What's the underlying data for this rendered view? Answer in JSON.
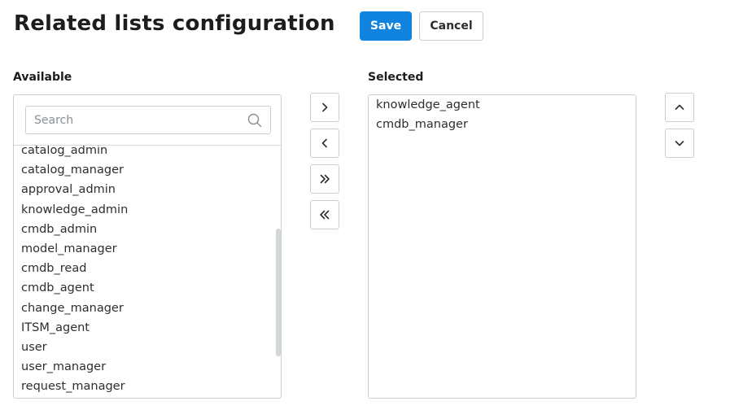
{
  "page": {
    "title": "Related lists configuration"
  },
  "toolbar": {
    "save_label": "Save",
    "cancel_label": "Cancel"
  },
  "available": {
    "label": "Available",
    "search_placeholder": "Search",
    "items": [
      "catalog_admin",
      "catalog_manager",
      "approval_admin",
      "knowledge_admin",
      "cmdb_admin",
      "model_manager",
      "cmdb_read",
      "cmdb_agent",
      "change_manager",
      "ITSM_agent",
      "user",
      "user_manager",
      "request_manager"
    ]
  },
  "selected": {
    "label": "Selected",
    "items": [
      "knowledge_agent",
      "cmdb_manager"
    ]
  },
  "transfer_buttons": [
    "move-right",
    "move-left",
    "move-all-right",
    "move-all-left"
  ],
  "order_buttons": [
    "move-up",
    "move-down"
  ],
  "colors": {
    "accent": "#0f83de",
    "border": "#c9ced3",
    "text": "#2e2e2e"
  }
}
